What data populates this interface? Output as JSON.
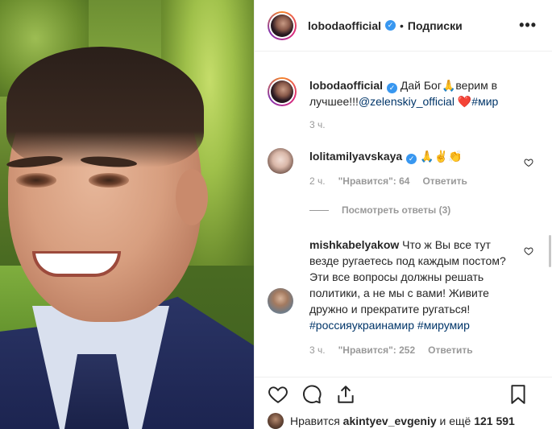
{
  "header": {
    "username": "lobodaofficial",
    "separator": "•",
    "follow_label": "Подписки",
    "more_label": "•••"
  },
  "verified_glyph": "✓",
  "caption": {
    "username": "lobodaofficial",
    "text_before": "Дай Бог",
    "emoji_pray": "🙏",
    "text_mid": "верим в лучшее!!!",
    "mention": "@zelenskiy_official",
    "emoji_heart": "❤️",
    "hashtag": "#мир",
    "time": "3 ч."
  },
  "comments": [
    {
      "username": "lolitamilyavskaya",
      "text": "🙏✌️👏",
      "time": "2 ч.",
      "likes": "\"Нравится\": 64",
      "reply": "Ответить"
    },
    {
      "username": "mishkabelyakow",
      "text": "Что ж Вы все тут везде ругаетесь под каждым постом? Эти все вопросы должны решать политики, а не мы с вами! Живите дружно и прекратите ругаться!",
      "hashtags": "#россияукраинамир #мирумир",
      "time": "3 ч.",
      "likes": "\"Нравится\": 252",
      "reply": "Ответить"
    }
  ],
  "view_replies": "Посмотреть ответы (3)",
  "likes_bar": {
    "prefix": "Нравится",
    "user": "akintyev_evgeniy",
    "middle": "и ещё",
    "count": "121 591"
  },
  "colors": {
    "verified": "#3897f0",
    "link": "#003569",
    "heart": "#ed4956",
    "muted": "#999999"
  }
}
